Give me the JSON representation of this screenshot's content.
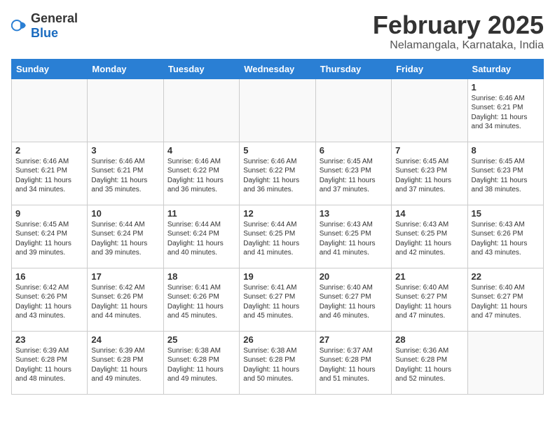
{
  "header": {
    "logo": {
      "general": "General",
      "blue": "Blue"
    },
    "title": "February 2025",
    "location": "Nelamangala, Karnataka, India"
  },
  "weekdays": [
    "Sunday",
    "Monday",
    "Tuesday",
    "Wednesday",
    "Thursday",
    "Friday",
    "Saturday"
  ],
  "weeks": [
    [
      {
        "day": "",
        "info": ""
      },
      {
        "day": "",
        "info": ""
      },
      {
        "day": "",
        "info": ""
      },
      {
        "day": "",
        "info": ""
      },
      {
        "day": "",
        "info": ""
      },
      {
        "day": "",
        "info": ""
      },
      {
        "day": "1",
        "info": "Sunrise: 6:46 AM\nSunset: 6:21 PM\nDaylight: 11 hours\nand 34 minutes."
      }
    ],
    [
      {
        "day": "2",
        "info": "Sunrise: 6:46 AM\nSunset: 6:21 PM\nDaylight: 11 hours\nand 34 minutes."
      },
      {
        "day": "3",
        "info": "Sunrise: 6:46 AM\nSunset: 6:21 PM\nDaylight: 11 hours\nand 35 minutes."
      },
      {
        "day": "4",
        "info": "Sunrise: 6:46 AM\nSunset: 6:22 PM\nDaylight: 11 hours\nand 36 minutes."
      },
      {
        "day": "5",
        "info": "Sunrise: 6:46 AM\nSunset: 6:22 PM\nDaylight: 11 hours\nand 36 minutes."
      },
      {
        "day": "6",
        "info": "Sunrise: 6:45 AM\nSunset: 6:23 PM\nDaylight: 11 hours\nand 37 minutes."
      },
      {
        "day": "7",
        "info": "Sunrise: 6:45 AM\nSunset: 6:23 PM\nDaylight: 11 hours\nand 37 minutes."
      },
      {
        "day": "8",
        "info": "Sunrise: 6:45 AM\nSunset: 6:23 PM\nDaylight: 11 hours\nand 38 minutes."
      }
    ],
    [
      {
        "day": "9",
        "info": "Sunrise: 6:45 AM\nSunset: 6:24 PM\nDaylight: 11 hours\nand 39 minutes."
      },
      {
        "day": "10",
        "info": "Sunrise: 6:44 AM\nSunset: 6:24 PM\nDaylight: 11 hours\nand 39 minutes."
      },
      {
        "day": "11",
        "info": "Sunrise: 6:44 AM\nSunset: 6:24 PM\nDaylight: 11 hours\nand 40 minutes."
      },
      {
        "day": "12",
        "info": "Sunrise: 6:44 AM\nSunset: 6:25 PM\nDaylight: 11 hours\nand 41 minutes."
      },
      {
        "day": "13",
        "info": "Sunrise: 6:43 AM\nSunset: 6:25 PM\nDaylight: 11 hours\nand 41 minutes."
      },
      {
        "day": "14",
        "info": "Sunrise: 6:43 AM\nSunset: 6:25 PM\nDaylight: 11 hours\nand 42 minutes."
      },
      {
        "day": "15",
        "info": "Sunrise: 6:43 AM\nSunset: 6:26 PM\nDaylight: 11 hours\nand 43 minutes."
      }
    ],
    [
      {
        "day": "16",
        "info": "Sunrise: 6:42 AM\nSunset: 6:26 PM\nDaylight: 11 hours\nand 43 minutes."
      },
      {
        "day": "17",
        "info": "Sunrise: 6:42 AM\nSunset: 6:26 PM\nDaylight: 11 hours\nand 44 minutes."
      },
      {
        "day": "18",
        "info": "Sunrise: 6:41 AM\nSunset: 6:26 PM\nDaylight: 11 hours\nand 45 minutes."
      },
      {
        "day": "19",
        "info": "Sunrise: 6:41 AM\nSunset: 6:27 PM\nDaylight: 11 hours\nand 45 minutes."
      },
      {
        "day": "20",
        "info": "Sunrise: 6:40 AM\nSunset: 6:27 PM\nDaylight: 11 hours\nand 46 minutes."
      },
      {
        "day": "21",
        "info": "Sunrise: 6:40 AM\nSunset: 6:27 PM\nDaylight: 11 hours\nand 47 minutes."
      },
      {
        "day": "22",
        "info": "Sunrise: 6:40 AM\nSunset: 6:27 PM\nDaylight: 11 hours\nand 47 minutes."
      }
    ],
    [
      {
        "day": "23",
        "info": "Sunrise: 6:39 AM\nSunset: 6:28 PM\nDaylight: 11 hours\nand 48 minutes."
      },
      {
        "day": "24",
        "info": "Sunrise: 6:39 AM\nSunset: 6:28 PM\nDaylight: 11 hours\nand 49 minutes."
      },
      {
        "day": "25",
        "info": "Sunrise: 6:38 AM\nSunset: 6:28 PM\nDaylight: 11 hours\nand 49 minutes."
      },
      {
        "day": "26",
        "info": "Sunrise: 6:38 AM\nSunset: 6:28 PM\nDaylight: 11 hours\nand 50 minutes."
      },
      {
        "day": "27",
        "info": "Sunrise: 6:37 AM\nSunset: 6:28 PM\nDaylight: 11 hours\nand 51 minutes."
      },
      {
        "day": "28",
        "info": "Sunrise: 6:36 AM\nSunset: 6:28 PM\nDaylight: 11 hours\nand 52 minutes."
      },
      {
        "day": "",
        "info": ""
      }
    ]
  ]
}
